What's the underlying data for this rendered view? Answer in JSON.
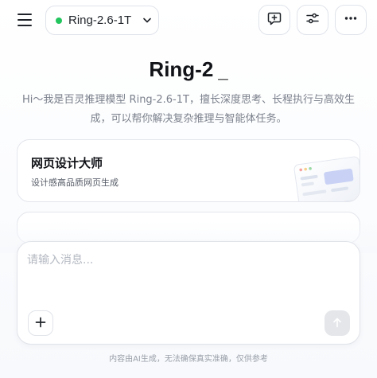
{
  "header": {
    "menu_icon": "hamburger-menu-icon",
    "model": {
      "name": "Ring-2.6-1T",
      "status_color": "#22c55e",
      "chevron_icon": "chevron-down-icon"
    },
    "actions": [
      {
        "icon": "new-chat-icon"
      },
      {
        "icon": "settings-sliders-icon"
      },
      {
        "icon": "more-horizontal-icon"
      }
    ]
  },
  "hero": {
    "title": "Ring-2",
    "cursor": "_",
    "intro": "Hi～我是百灵推理模型 Ring-2.6-1T，擅长深度思考、长程执行与高效生成，可以帮你解决复杂推理与智能体任务。"
  },
  "cards": [
    {
      "title": "网页设计大师",
      "subtitle": "设计感高品质网页生成",
      "illustration_icon": "webpage-preview-icon"
    }
  ],
  "composer": {
    "placeholder": "请输入消息...",
    "value": "",
    "add_icon": "plus-icon",
    "send_icon": "send-arrow-up-icon"
  },
  "footer": {
    "disclaimer": "内容由AI生成，无法确保真实准确，仅供参考"
  },
  "colors": {
    "accent_status": "#22c55e",
    "border": "#dfe3ea",
    "muted_text": "#7b818c"
  }
}
